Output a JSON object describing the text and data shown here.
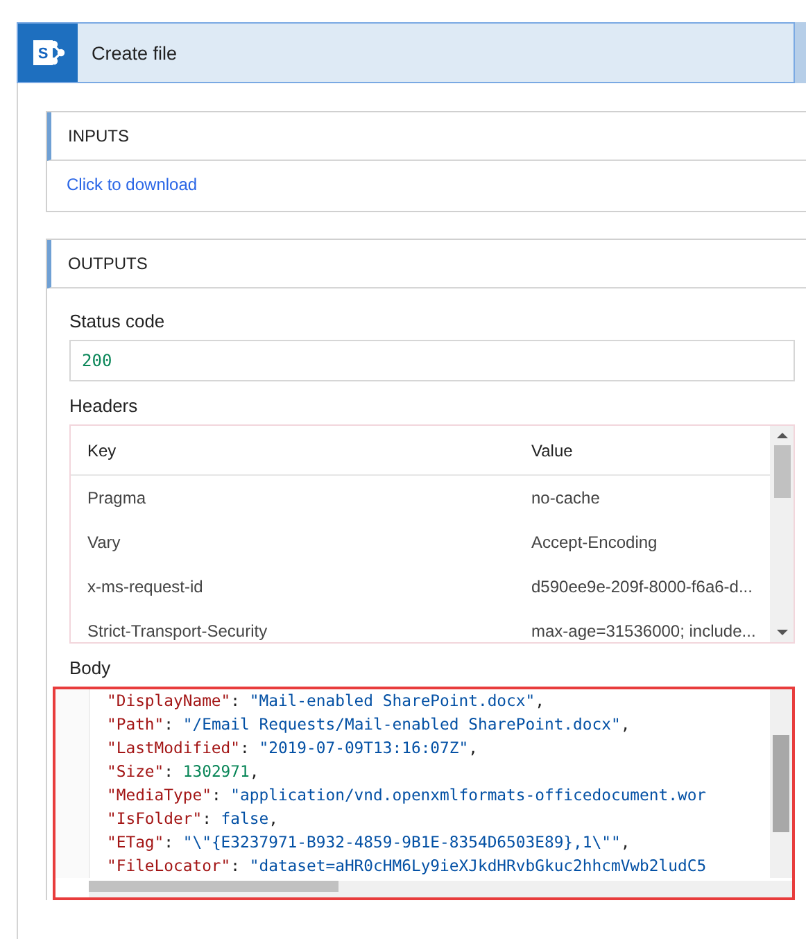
{
  "header": {
    "logo_letter": "S",
    "title": "Create file"
  },
  "inputs": {
    "title": "INPUTS",
    "link": "Click to download"
  },
  "outputs": {
    "title": "OUTPUTS",
    "status_code": {
      "label": "Status code",
      "value": "200"
    },
    "headers": {
      "label": "Headers",
      "columns": [
        "Key",
        "Value"
      ],
      "rows": [
        {
          "key": "Pragma",
          "value": "no-cache"
        },
        {
          "key": "Vary",
          "value": "Accept-Encoding"
        },
        {
          "key": "x-ms-request-id",
          "value": "d590ee9e-209f-8000-f6a6-d..."
        },
        {
          "key": "Strict-Transport-Security",
          "value": "max-age=31536000; include..."
        }
      ]
    },
    "body": {
      "label": "Body",
      "lines": [
        {
          "key": "\"DisplayName\"",
          "sep": ":",
          "value": "\"Mail-enabled SharePoint.docx\"",
          "kind": "string",
          "trail": ","
        },
        {
          "key": "\"Path\"",
          "sep": ":",
          "value": "\"/Email Requests/Mail-enabled SharePoint.docx\"",
          "kind": "string",
          "trail": ","
        },
        {
          "key": "\"LastModified\"",
          "sep": ":",
          "value": "\"2019-07-09T13:16:07Z\"",
          "kind": "string",
          "trail": ","
        },
        {
          "key": "\"Size\"",
          "sep": ":",
          "value": "1302971",
          "kind": "number",
          "trail": ","
        },
        {
          "key": "\"MediaType\"",
          "sep": ":",
          "value": "\"application/vnd.openxmlformats-officedocument.wor",
          "kind": "string"
        },
        {
          "key": "\"IsFolder\"",
          "sep": ":",
          "value": "false",
          "kind": "boolean",
          "trail": ","
        },
        {
          "key": "\"ETag\"",
          "sep": ":",
          "value": "\"\\\"{E3237971-B932-4859-9B1E-8354D6503E89},1\\\"\"",
          "kind": "string",
          "trail": ","
        },
        {
          "key": "\"FileLocator\"",
          "sep": ":",
          "value": "\"dataset=aHR0cHM6Ly9ieXJkdHRvbGkuc2hhcmVwb2ludC5",
          "kind": "string"
        }
      ]
    }
  }
}
